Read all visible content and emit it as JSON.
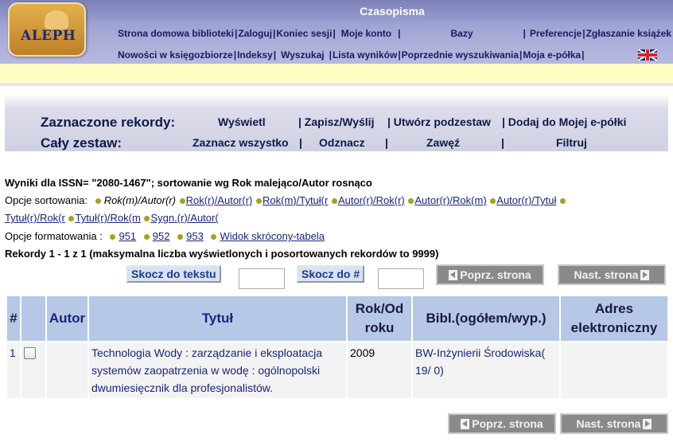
{
  "header": {
    "title": "Czasopisma",
    "logo_text": "ALEPH",
    "nav_row1": [
      {
        "label": "Strona domowa biblioteki"
      },
      {
        "label": "Zaloguj"
      },
      {
        "label": "Koniec sesji"
      },
      {
        "label": "Moje konto"
      },
      {
        "label": "Bazy"
      },
      {
        "label": "Preferencje"
      },
      {
        "label": "Zgłaszanie książek do"
      }
    ],
    "nav_row2": [
      {
        "label": "Nowości w księgozbiorze"
      },
      {
        "label": "Indeksy"
      },
      {
        "label": "Wyszukaj"
      },
      {
        "label": "Lista wyników"
      },
      {
        "label": "Poprzednie wyszukiwania"
      },
      {
        "label": "Moja e-półka"
      }
    ]
  },
  "actions": {
    "selected_label": "Zaznaczone rekordy:",
    "selected_items": [
      "Wyświetl",
      "| Zapisz/Wyślij",
      "| Utwórz podzestaw",
      "| Dodaj do Mojej e-półki"
    ],
    "set_label": "Cały zestaw:",
    "set_items": [
      "Zaznacz wszystko",
      "|",
      "Odznacz",
      "|",
      "Zawęź",
      "|",
      "Filtruj"
    ]
  },
  "results": {
    "title": "Wyniki dla ISSN= \"2080-1467\"; sortowanie wg Rok malejąco/Autor rosnąco",
    "sort_label": "Opcje sortowania:",
    "sort_current": "Rok(m)/Autor(r)",
    "sort_options_line1": [
      "Rok(r)/Autor(r)",
      "Rok(m)/Tytuł(r",
      "Autor(r)/Rok(r)",
      "Autor(r)/Rok(m)",
      "Autor(r)/Tytuł"
    ],
    "sort_options_line2": [
      "Tytuł(r)/Rok(r",
      "Tytuł(r)/Rok(m",
      "Sygn.(r)/Autor("
    ],
    "format_label": "Opcje formatowania :",
    "format_options": [
      "951",
      "952",
      "953",
      "Widok skrócony-tabela"
    ],
    "records_info": "Rekordy 1 - 1 z 1 (maksymalna liczba wyświetlonych i posortowanych rekordów to 9999)"
  },
  "controls": {
    "jump_text_label": "Skocz do tekstu",
    "jump_num_label": "Skocz do #",
    "prev_label": "Poprz. strona",
    "next_label": "Nast. strona"
  },
  "table": {
    "headers": {
      "num": "#",
      "author": "Autor",
      "title": "Tytuł",
      "year_line1": "Rok/Od",
      "year_line2": "roku",
      "holdings": "Bibl.(ogółem/wyp.)",
      "url_line1": "Adres",
      "url_line2": "elektroniczny"
    },
    "rows": [
      {
        "num": "1",
        "author": "",
        "title_line1": "Technologia Wody : zarządzanie i eksploatacja",
        "title_line2": "systemów zaopatrzenia w wodę : ogólnopolski",
        "title_line3": "dwumiesięcznik dla profesjonalistów.",
        "year": "2009",
        "holdings_line1": "BW-Inżynierii Środowiska(",
        "holdings_line2": "19/ 0)",
        "url": ""
      }
    ]
  }
}
